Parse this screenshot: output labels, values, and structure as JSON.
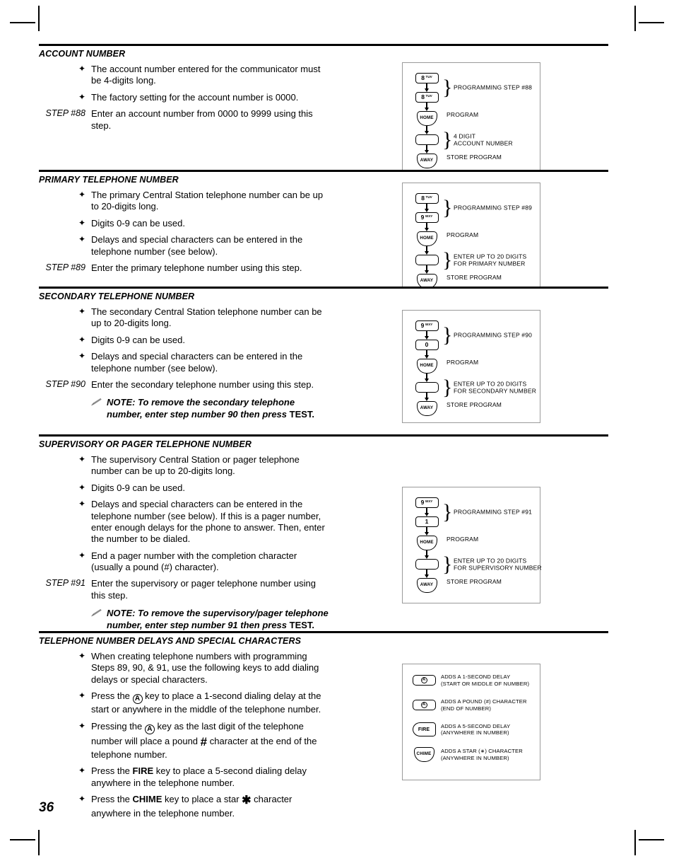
{
  "page": {
    "number": "36"
  },
  "sections": [
    {
      "id": "account-number",
      "title": "ACCOUNT NUMBER",
      "bullets": [
        "The account number entered for the communicator must be 4-digits long.",
        "The factory setting for the account number is 0000."
      ],
      "step_label": "STEP #88",
      "step_text": "Enter an account number from 0000 to 9999 using this step.",
      "note": null,
      "diagram": {
        "type": "program-sequence",
        "pair_label": "PROGRAMMING STEP #88",
        "keys": [
          {
            "shape": "digit",
            "digit": "8",
            "letters": "TUV"
          },
          {
            "shape": "digit",
            "digit": "8",
            "letters": "TUV"
          }
        ],
        "rows": [
          {
            "key": {
              "shape": "shield",
              "text": "HOME"
            },
            "label": "PROGRAM",
            "brace": false
          },
          {
            "key": {
              "shape": "blank",
              "text": ""
            },
            "label": "4 DIGIT\nACCOUNT NUMBER",
            "brace": true
          },
          {
            "key": {
              "shape": "shield",
              "text": "AWAY"
            },
            "label": "STORE PROGRAM",
            "brace": false
          }
        ]
      }
    },
    {
      "id": "primary-telephone-number",
      "title": "PRIMARY TELEPHONE NUMBER",
      "bullets": [
        "The primary Central Station telephone number can be up to 20-digits long.",
        "Digits 0-9 can be used.",
        "Delays and special characters can be entered in the telephone number (see below)."
      ],
      "step_label": "STEP #89",
      "step_text": "Enter the primary telephone number using this step.",
      "note": null,
      "diagram": {
        "type": "program-sequence",
        "pair_label": "PROGRAMMING STEP #89",
        "keys": [
          {
            "shape": "digit",
            "digit": "8",
            "letters": "TUV"
          },
          {
            "shape": "digit",
            "digit": "9",
            "letters": "WXY"
          }
        ],
        "rows": [
          {
            "key": {
              "shape": "shield",
              "text": "HOME"
            },
            "label": "PROGRAM",
            "brace": false
          },
          {
            "key": {
              "shape": "blank",
              "text": ""
            },
            "label": "ENTER UP TO 20 DIGITS\nFOR PRIMARY NUMBER",
            "brace": true
          },
          {
            "key": {
              "shape": "shield",
              "text": "AWAY"
            },
            "label": "STORE PROGRAM",
            "brace": false
          }
        ]
      }
    },
    {
      "id": "secondary-telephone-number",
      "title": "SECONDARY TELEPHONE NUMBER",
      "bullets": [
        "The secondary Central Station telephone number can be up to 20-digits long.",
        "Digits 0-9 can be used.",
        "Delays and special characters can be entered in the telephone number (see below)."
      ],
      "step_label": "STEP #90",
      "step_text": "Enter the secondary telephone number using this step.",
      "note": {
        "icon": "pencil-icon",
        "bold_text": "NOTE: To remove the secondary telephone number, enter step number 90 then press ",
        "upright_text": "TEST."
      },
      "diagram": {
        "type": "program-sequence",
        "pair_label": "PROGRAMMING STEP #90",
        "keys": [
          {
            "shape": "digit",
            "digit": "9",
            "letters": "WXY"
          },
          {
            "shape": "digit",
            "digit": "0",
            "letters": ""
          }
        ],
        "rows": [
          {
            "key": {
              "shape": "shield",
              "text": "HOME"
            },
            "label": "PROGRAM",
            "brace": false
          },
          {
            "key": {
              "shape": "blank",
              "text": ""
            },
            "label": "ENTER UP TO 20 DIGITS\nFOR SECONDARY NUMBER",
            "brace": true
          },
          {
            "key": {
              "shape": "shield",
              "text": "AWAY"
            },
            "label": "STORE PROGRAM",
            "brace": false
          }
        ]
      }
    },
    {
      "id": "supervisory-or-pager-telephone-number",
      "title": "SUPERVISORY OR PAGER TELEPHONE NUMBER",
      "bullets": [
        "The supervisory Central Station or pager telephone number can be up to 20-digits long.",
        "Digits 0-9 can be used.",
        "Delays and special characters can be entered in the telephone number (see below). If this is a pager number, enter enough delays for the phone to answer. Then, enter the number to be dialed.",
        "End a pager number with the completion character (usually a pound (#) character)."
      ],
      "step_label": "STEP #91",
      "step_text": "Enter the supervisory or pager telephone number using this step.",
      "note": {
        "icon": "pencil-icon",
        "bold_text": "NOTE: To remove the supervisory/pager telephone number, enter step number 91 then press ",
        "upright_text": "TEST."
      },
      "diagram": {
        "type": "program-sequence",
        "pair_label": "PROGRAMMING STEP #91",
        "keys": [
          {
            "shape": "digit",
            "digit": "9",
            "letters": "WXY"
          },
          {
            "shape": "digit",
            "digit": "1",
            "letters": ""
          }
        ],
        "rows": [
          {
            "key": {
              "shape": "shield",
              "text": "HOME"
            },
            "label": "PROGRAM",
            "brace": false
          },
          {
            "key": {
              "shape": "blank",
              "text": ""
            },
            "label": "ENTER UP TO 20 DIGITS\nFOR SUPERVISORY NUMBER",
            "brace": true
          },
          {
            "key": {
              "shape": "shield",
              "text": "AWAY"
            },
            "label": "STORE PROGRAM",
            "brace": false
          }
        ]
      }
    },
    {
      "id": "telephone-number-delays-and-special-characters",
      "title": "TELEPHONE NUMBER DELAYS AND SPECIAL CHARACTERS",
      "bullets_rich": [
        {
          "parts": [
            {
              "t": "text",
              "v": "When creating telephone numbers with programming Steps 89, 90, & 91, use the following keys to add dialing delays or special characters."
            }
          ]
        },
        {
          "parts": [
            {
              "t": "text",
              "v": "Press the "
            },
            {
              "t": "circle-a"
            },
            {
              "t": "text",
              "v": " key to place a 1-second dialing delay at the start or anywhere in the middle of the telephone number."
            }
          ]
        },
        {
          "parts": [
            {
              "t": "text",
              "v": "Pressing the "
            },
            {
              "t": "circle-a"
            },
            {
              "t": "text",
              "v": " key as the last digit of the telephone number will place a pound "
            },
            {
              "t": "pound"
            },
            {
              "t": "text",
              "v": " character at the end of the telephone number."
            }
          ]
        },
        {
          "parts": [
            {
              "t": "text",
              "v": "Press the "
            },
            {
              "t": "bold",
              "v": "FIRE"
            },
            {
              "t": "text",
              "v": " key to place a 5-second dialing delay anywhere in the telephone number."
            }
          ]
        },
        {
          "parts": [
            {
              "t": "text",
              "v": "Press the "
            },
            {
              "t": "bold",
              "v": "CHIME"
            },
            {
              "t": "text",
              "v": " key to place a star "
            },
            {
              "t": "star"
            },
            {
              "t": "text",
              "v": " character anywhere in the telephone number."
            }
          ]
        }
      ],
      "diagram": {
        "type": "key-legend",
        "rows": [
          {
            "key": {
              "shape": "inline-a",
              "text": ""
            },
            "line1": "ADDS A 1-SECOND DELAY",
            "line2": "(START OR MIDDLE OF NUMBER)"
          },
          {
            "key": {
              "shape": "inline-a",
              "text": ""
            },
            "line1": "ADDS A POUND (#) CHARACTER",
            "line2": "(END OF NUMBER)"
          },
          {
            "key": {
              "shape": "fire",
              "text": "FIRE"
            },
            "line1": "ADDS A 5-SECOND DELAY",
            "line2": "(ANYWHERE IN NUMBER)"
          },
          {
            "key": {
              "shape": "shield",
              "text": "CHIME"
            },
            "line1": "ADDS A STAR (∗) CHARACTER",
            "line2": "(ANYWHERE IN NUMBER)"
          }
        ]
      }
    }
  ],
  "icons": {
    "bullet": "✦",
    "pencil": "pencil-icon",
    "pound": "#",
    "star": "✱",
    "brace": "}"
  }
}
